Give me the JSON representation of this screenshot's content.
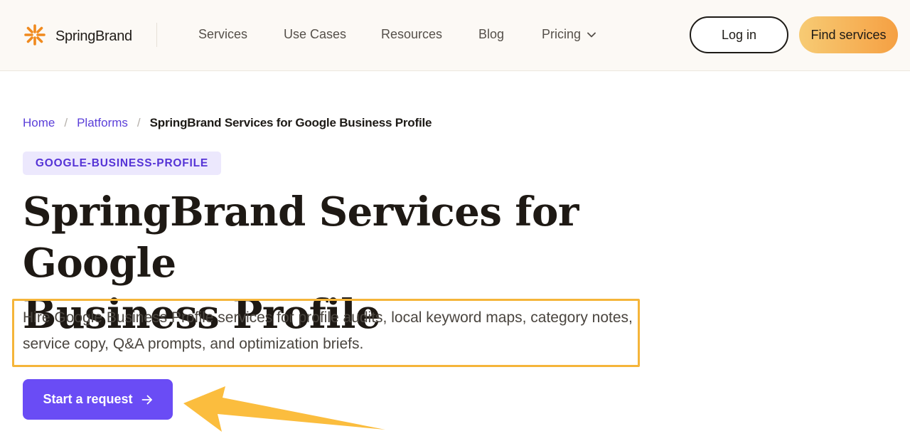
{
  "header": {
    "brand": "SpringBrand",
    "nav": {
      "services": "Services",
      "use_cases": "Use Cases",
      "resources": "Resources",
      "blog": "Blog",
      "pricing": "Pricing"
    },
    "login_label": "Log in",
    "cta_label": "Find services"
  },
  "breadcrumb": {
    "home": "Home",
    "platforms": "Platforms",
    "current": "SpringBrand Services for Google Business Profile",
    "separator": "/"
  },
  "main": {
    "tag": "GOOGLE-BUSINESS-PROFILE",
    "title_line1": "SpringBrand Services for Google",
    "title_line2": "Business Profile",
    "description": "Hire Google Business Profile services for profile audits, local keyword maps, category notes, service copy, Q&A prompts, and optimization briefs.",
    "cta_label": "Start a request"
  },
  "colors": {
    "accent": "#6a4cf5",
    "link": "#5b3fd9",
    "highlight": "#f5b53a",
    "brand_orange": "#f08a1e"
  },
  "icons": [
    "springbrand-logo-icon",
    "chevron-down-icon",
    "arrow-right-icon",
    "annotation-arrow-icon"
  ]
}
